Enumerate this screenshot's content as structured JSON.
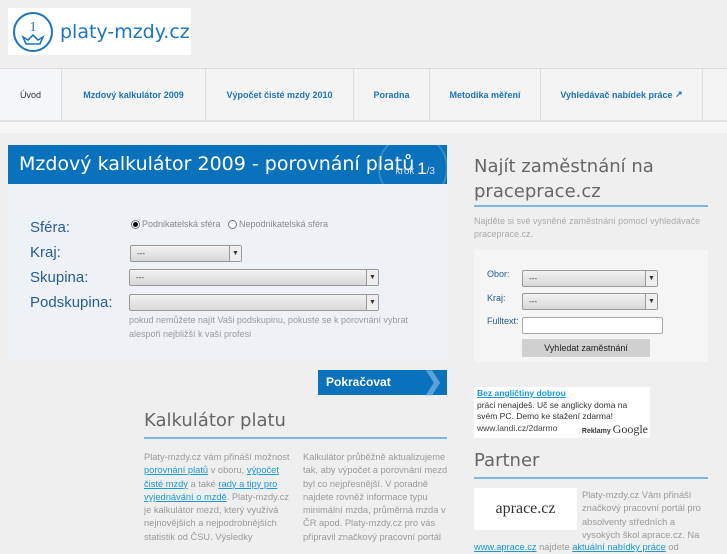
{
  "logo": {
    "text": "platy-mzdy.cz"
  },
  "nav": [
    {
      "label": "Úvod",
      "active": true
    },
    {
      "label": "Mzdový kalkulátor 2009"
    },
    {
      "label": "Výpočet čisté mzdy 2010"
    },
    {
      "label": "Poradna"
    },
    {
      "label": "Metodika měření"
    },
    {
      "label": "Vyhledávač nabídek práce",
      "icon": "external-link-icon"
    }
  ],
  "calc": {
    "title": "Mzdový kalkulátor 2009 - porovnání platů",
    "step_word": "krok",
    "step": "1",
    "step_total": "/3",
    "labels": {
      "sfera": "Sféra:",
      "kraj": "Kraj:",
      "skupina": "Skupina:",
      "podskupina": "Podskupina:"
    },
    "radios": [
      "Podnikatelská sféra",
      "Nepodnikatelská sféra"
    ],
    "kraj_value": "---",
    "skupina_value": "---",
    "podskupina_value": "",
    "hint": "pokud nemůžete najít Vaši podskupinu, pokuste se k porovnání vybrat alespoň nejbližší k vaší profesi",
    "continue": "Pokračovat"
  },
  "about": {
    "title": "Kalkulátor platu",
    "c1": {
      "t1": "Platy-mzdy.cz vám přináší možnost ",
      "l1": "porovnání platů",
      "t2": " v oboru, ",
      "l2": "výpočet čisté mzdy",
      "t3": " a také ",
      "l3": "rady a tipy pro vyjednávání o mzdě",
      "t4": ". Platy-mzdy.cz je kalkulátor mezd, který využívá nejnovějších a nejpodrobnějších statistik od ČSU. Výsledky"
    },
    "c2": "Kalkulátor průběžně aktualizujeme tak, aby výpočet a porovnání mezd byl co nejpřesnější. V poradně najdete rovněž informace typu minimální mzda, průměrná mzda v ČR apod. Platy-mzdy.cz pro vás připravil značkový pracovní portál"
  },
  "jobs": {
    "title": "Najít zaměstnání na praceprace.cz",
    "desc": "Najděte si své vysněné zaměstnání pomocí vyhledávače praceprace.cz.",
    "obor": "Obor:",
    "kraj": "Kraj:",
    "fulltext": "Fulltext:",
    "obor_value": "---",
    "kraj_value": "---",
    "button": "Vyhledat zaměstnání"
  },
  "ad": {
    "title": "Bez angličtiny dobrou",
    "text": "práci nenajdeš. Uč se anglicky doma na svém PC. Demo ke stažení zdarma!",
    "url": "www.landi.cz/2darmo",
    "label": "Reklamy",
    "brand": "Google"
  },
  "partner": {
    "title": "Partner",
    "logo": "aprace.cz",
    "text": "Platy-mzdy.cz Vám přináší značkový pracovní portál pro absolventy středních a vysokých škol aprace.cz. Na",
    "link1": "www.aprace.cz",
    "t2": " najdete ",
    "link2": "aktuální nabídky práce",
    "t3": " od"
  }
}
